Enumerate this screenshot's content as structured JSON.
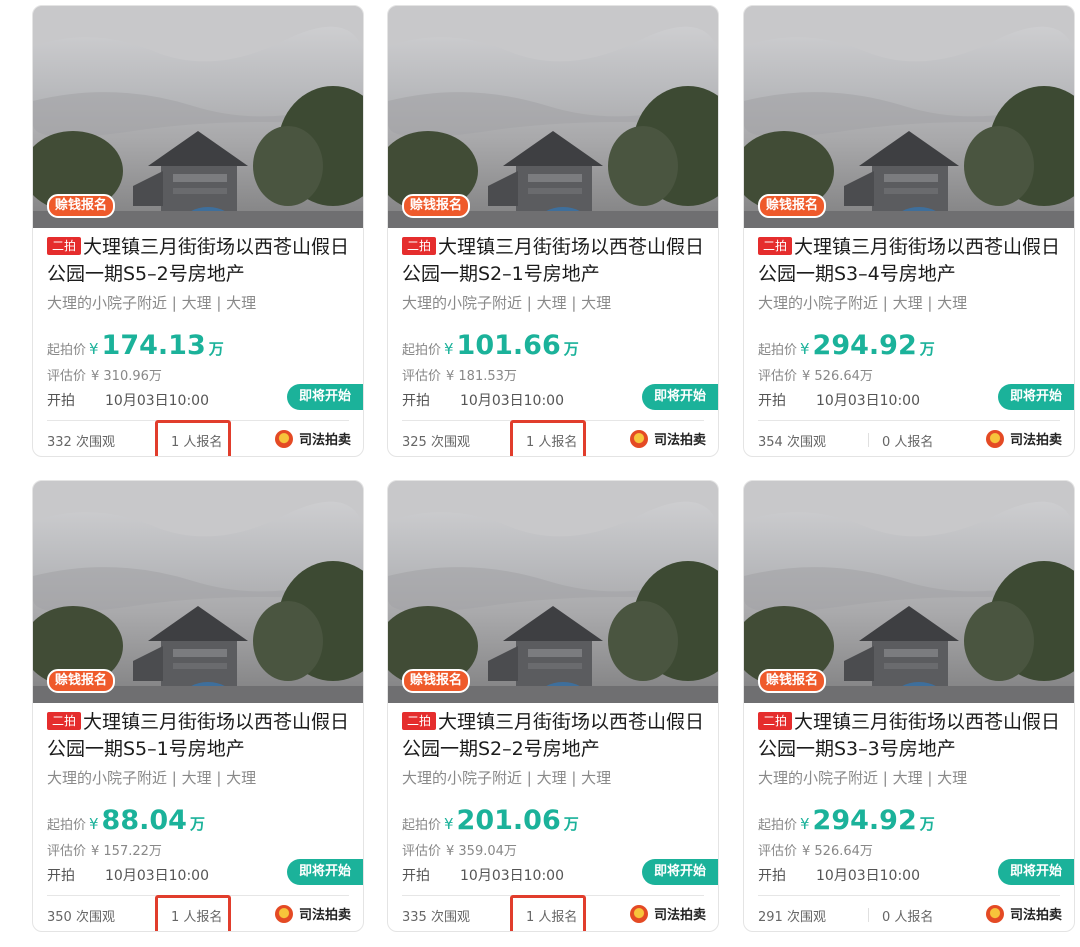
{
  "colors": {
    "accent": "#1bb29a",
    "badge": "#e52d2d",
    "deposit": "#ef5a2b",
    "highlight": "#e13d2c"
  },
  "cards": [
    {
      "deposit_tag": "赊钱报名",
      "round": "二拍",
      "title": "大理镇三月街街场以西苍山假日公园一期S5–2号房地产",
      "location": "大理的小院子附近 | 大理 | 大理",
      "start_label": "起拍价",
      "start_currency": "¥",
      "start_price": "174.13",
      "start_unit": "万",
      "est_label": "评估价",
      "est_value": "¥ 310.96万",
      "time_label": "开拍",
      "time_value": "10月03日10:00",
      "status": "即将开始",
      "views": "332 次围观",
      "signups": "1 人报名",
      "signups_highlighted": true,
      "court": "司法拍卖",
      "emblem_icon": "court-emblem-icon"
    },
    {
      "deposit_tag": "赊钱报名",
      "round": "二拍",
      "title": "大理镇三月街街场以西苍山假日公园一期S2–1号房地产",
      "location": "大理的小院子附近 | 大理 | 大理",
      "start_label": "起拍价",
      "start_currency": "¥",
      "start_price": "101.66",
      "start_unit": "万",
      "est_label": "评估价",
      "est_value": "¥ 181.53万",
      "time_label": "开拍",
      "time_value": "10月03日10:00",
      "status": "即将开始",
      "views": "325 次围观",
      "signups": "1 人报名",
      "signups_highlighted": true,
      "court": "司法拍卖",
      "emblem_icon": "court-emblem-icon"
    },
    {
      "deposit_tag": "赊钱报名",
      "round": "二拍",
      "title": "大理镇三月街街场以西苍山假日公园一期S3–4号房地产",
      "location": "大理的小院子附近 | 大理 | 大理",
      "start_label": "起拍价",
      "start_currency": "¥",
      "start_price": "294.92",
      "start_unit": "万",
      "est_label": "评估价",
      "est_value": "¥ 526.64万",
      "time_label": "开拍",
      "time_value": "10月03日10:00",
      "status": "即将开始",
      "views": "354 次围观",
      "signups": "0 人报名",
      "signups_highlighted": false,
      "court": "司法拍卖",
      "emblem_icon": "court-emblem-icon"
    },
    {
      "deposit_tag": "赊钱报名",
      "round": "二拍",
      "title": "大理镇三月街街场以西苍山假日公园一期S5–1号房地产",
      "location": "大理的小院子附近 | 大理 | 大理",
      "start_label": "起拍价",
      "start_currency": "¥",
      "start_price": "88.04",
      "start_unit": "万",
      "est_label": "评估价",
      "est_value": "¥ 157.22万",
      "time_label": "开拍",
      "time_value": "10月03日10:00",
      "status": "即将开始",
      "views": "350 次围观",
      "signups": "1 人报名",
      "signups_highlighted": true,
      "court": "司法拍卖",
      "emblem_icon": "court-emblem-icon"
    },
    {
      "deposit_tag": "赊钱报名",
      "round": "二拍",
      "title": "大理镇三月街街场以西苍山假日公园一期S2–2号房地产",
      "location": "大理的小院子附近 | 大理 | 大理",
      "start_label": "起拍价",
      "start_currency": "¥",
      "start_price": "201.06",
      "start_unit": "万",
      "est_label": "评估价",
      "est_value": "¥ 359.04万",
      "time_label": "开拍",
      "time_value": "10月03日10:00",
      "status": "即将开始",
      "views": "335 次围观",
      "signups": "1 人报名",
      "signups_highlighted": true,
      "court": "司法拍卖",
      "emblem_icon": "court-emblem-icon"
    },
    {
      "deposit_tag": "赊钱报名",
      "round": "二拍",
      "title": "大理镇三月街街场以西苍山假日公园一期S3–3号房地产",
      "location": "大理的小院子附近 | 大理 | 大理",
      "start_label": "起拍价",
      "start_currency": "¥",
      "start_price": "294.92",
      "start_unit": "万",
      "est_label": "评估价",
      "est_value": "¥ 526.64万",
      "time_label": "开拍",
      "time_value": "10月03日10:00",
      "status": "即将开始",
      "views": "291 次围观",
      "signups": "0 人报名",
      "signups_highlighted": false,
      "court": "司法拍卖",
      "emblem_icon": "court-emblem-icon"
    }
  ]
}
